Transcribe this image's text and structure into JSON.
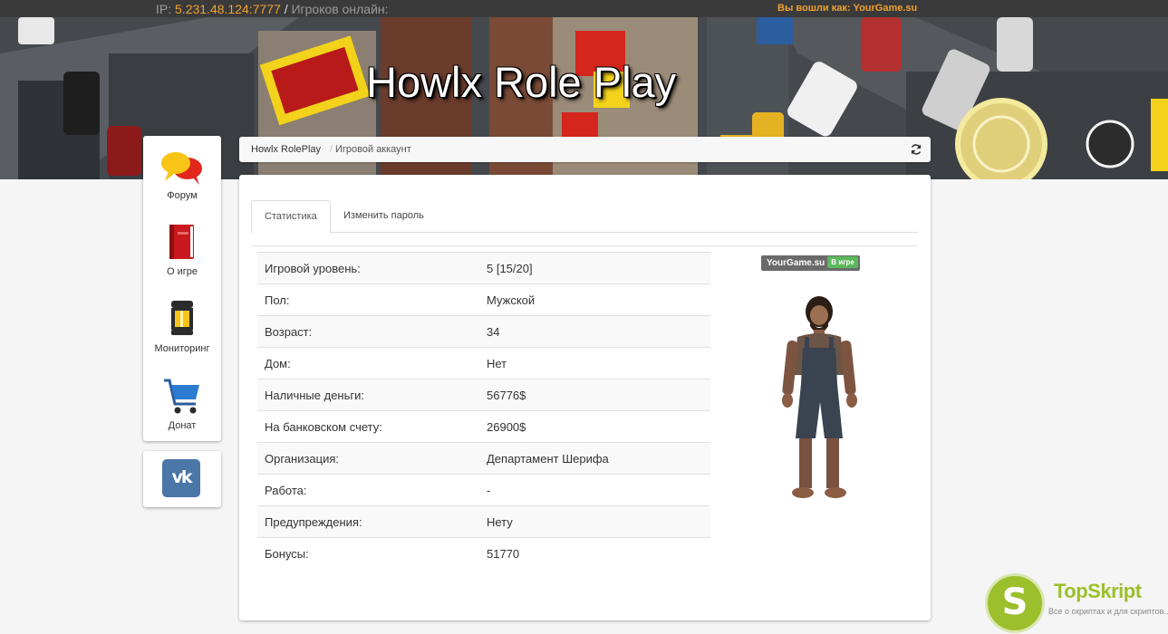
{
  "topbar": {
    "ip_label": "IP:",
    "ip_value": "5.231.48.124:7777",
    "separator": "/",
    "online_label": "Игроков онлайн:",
    "login_text": "Вы вошли как: YourGame.su"
  },
  "banner": {
    "title": "Howlx Role Play"
  },
  "sidebar": {
    "items": [
      {
        "label": "Форум",
        "icon": "chat-bubbles-icon"
      },
      {
        "label": "О игре",
        "icon": "book-icon"
      },
      {
        "label": "Мониторинг",
        "icon": "monitoring-lantern-icon"
      },
      {
        "label": "Донат",
        "icon": "shopping-cart-icon"
      }
    ],
    "social": {
      "icon": "vk-icon",
      "text": "vk"
    }
  },
  "breadcrumb": {
    "items": [
      "Howlx RolePlay",
      "Игровой аккаунт"
    ],
    "separator": "/",
    "action_icon": "refresh-icon"
  },
  "tabs": [
    {
      "label": "Статистика",
      "active": true
    },
    {
      "label": "Изменить пароль",
      "active": false
    }
  ],
  "stats": [
    {
      "key": "Игровой уровень:",
      "value": "5 [15/20]"
    },
    {
      "key": "Пол:",
      "value": "Мужской"
    },
    {
      "key": "Возраст:",
      "value": "34"
    },
    {
      "key": "Дом:",
      "value": "Нет"
    },
    {
      "key": "Наличные деньги:",
      "value": "56776$"
    },
    {
      "key": "На банковском счету:",
      "value": "26900$"
    },
    {
      "key": "Организация:",
      "value": "Департамент Шерифа"
    },
    {
      "key": "Работа:",
      "value": "-"
    },
    {
      "key": "Предупреждения:",
      "value": "Нету"
    },
    {
      "key": "Бонусы:",
      "value": "51770"
    }
  ],
  "player": {
    "name": "YourGame.su",
    "status": "В игре",
    "status_color": "#5cb85c"
  },
  "watermark": {
    "letter": "S",
    "name": "TopSkript",
    "tagline": "Все о скриптах и для скриптов..."
  },
  "colors": {
    "accent": "#f0a030",
    "topbar": "#3a3a3a",
    "vk": "#4a76a8",
    "watermark": "#9cbf2c"
  }
}
